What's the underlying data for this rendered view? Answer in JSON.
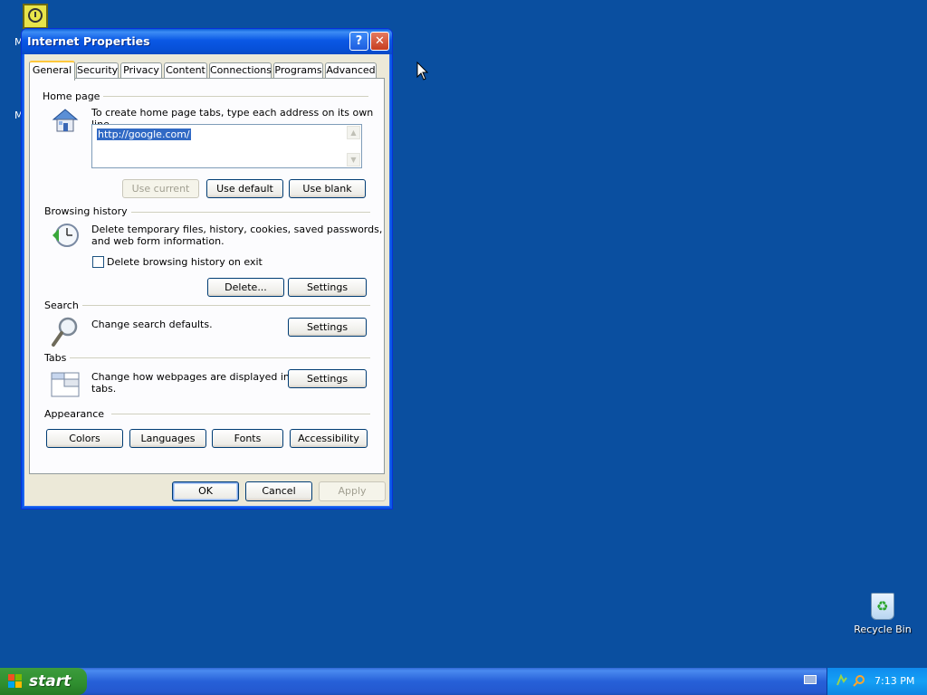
{
  "desktop": {
    "fragments": [
      "M",
      "M"
    ],
    "recycle_bin_label": "Recycle Bin"
  },
  "window": {
    "title": "Internet Properties",
    "help_label": "?",
    "close_label": "✕",
    "tabs": [
      {
        "label": "General",
        "active": true
      },
      {
        "label": "Security"
      },
      {
        "label": "Privacy"
      },
      {
        "label": "Content"
      },
      {
        "label": "Connections"
      },
      {
        "label": "Programs"
      },
      {
        "label": "Advanced"
      }
    ],
    "home_page": {
      "group_label": "Home page",
      "instruction": "To create home page tabs, type each address on its own line.",
      "url_value": "http://google.com/",
      "use_current_label": "Use current",
      "use_default_label": "Use default",
      "use_blank_label": "Use blank"
    },
    "browsing_history": {
      "group_label": "Browsing history",
      "description_line1": "Delete temporary files, history, cookies, saved passwords,",
      "description_line2": "and web form information.",
      "checkbox_label": "Delete browsing history on exit",
      "delete_label": "Delete...",
      "settings_label": "Settings"
    },
    "search": {
      "group_label": "Search",
      "description": "Change search defaults.",
      "settings_label": "Settings"
    },
    "tabs_section": {
      "group_label": "Tabs",
      "description_line1": "Change how webpages are displayed in",
      "description_line2": "tabs.",
      "settings_label": "Settings"
    },
    "appearance": {
      "group_label": "Appearance",
      "colors_label": "Colors",
      "languages_label": "Languages",
      "fonts_label": "Fonts",
      "accessibility_label": "Accessibility"
    },
    "footer": {
      "ok_label": "OK",
      "cancel_label": "Cancel",
      "apply_label": "Apply"
    }
  },
  "taskbar": {
    "start_label": "start",
    "clock": "7:13 PM"
  }
}
